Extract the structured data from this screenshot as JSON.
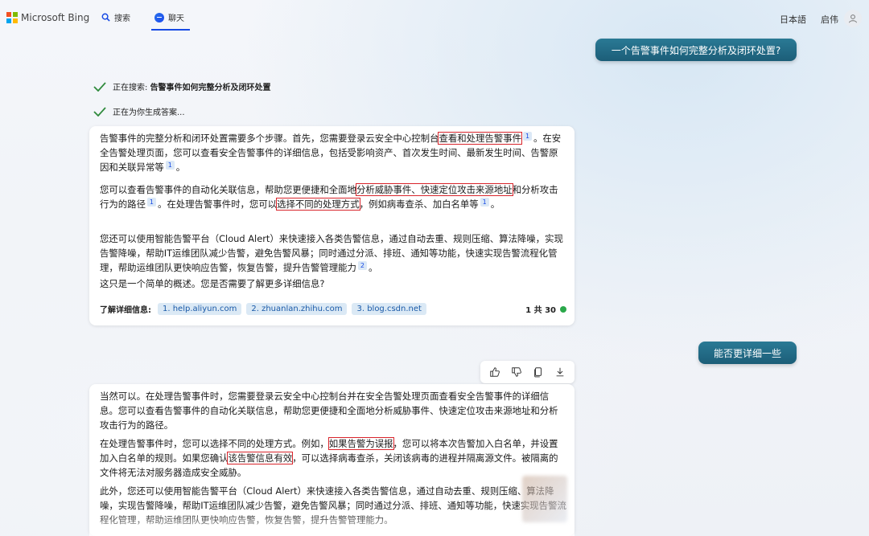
{
  "header": {
    "brand": "Microsoft Bing",
    "tabs": [
      {
        "label": "搜索"
      },
      {
        "label": "聊天"
      }
    ],
    "language": "日本語",
    "user_name": "启伟"
  },
  "colors": {
    "accent": "#174ae4",
    "user_bubble": "#1f6580",
    "highlight_box": "#d8242b",
    "live_dot": "#2aa84a"
  },
  "conversation": {
    "user_message_1": "一个告警事件如何完整分析及闭环处置?",
    "status_1_prefix": "正在搜索: ",
    "status_1_query": "告警事件如何完整分析及闭环处置",
    "status_2": "正在为你生成答案...",
    "answer_1": {
      "p1_a": "告警事件的完整分析和闭环处置需要多个步骤。首先，您需要登录云安全中心控制台",
      "p1_hl": "查看和处理告警事件",
      "p1_sup": "1",
      "p1_b": "。在安全告警处理页面，您可以查看安全告警事件的详细信息，包括受影响资产、首次发生时间、最新发生时间、告警原因和关联异常等",
      "p1_sup2": "1",
      "p1_c": "。",
      "p2_a": "您可以查看告警事件的自动化关联信息，帮助您更便捷和全面地",
      "p2_hl": "分析威胁事件、快速定位攻击来源地址",
      "p2_b": "和分析攻击行为的路径",
      "p2_sup": "1",
      "p2_c": "。在处理告警事件时，您可以",
      "p2_hl2": "选择不同的处理方式",
      "p2_d": "，例如病毒查杀、加白名单等",
      "p2_sup2": "1",
      "p2_e": "。",
      "p3": "您还可以使用智能告警平台（Cloud Alert）来快速接入各类告警信息，通过自动去重、规则压缩、算法降噪，实现告警降噪，帮助IT运维团队减少告警，避免告警风暴；同时通过分派、排班、通知等功能，快速实现告警流程化管理，帮助运维团队更快响应告警，恢复告警，提升告警管理能力",
      "p3_sup": "2",
      "p3_end": "。",
      "p4": "这只是一个简单的概述。您是否需要了解更多详细信息?",
      "learn_more_label": "了解详细信息:",
      "sources": [
        {
          "label": "1. help.aliyun.com"
        },
        {
          "label": "2. zhuanlan.zhihu.com"
        },
        {
          "label": "3. blog.csdn.net"
        }
      ],
      "counter": "1 共 30"
    },
    "user_message_2": "能否更详细一些",
    "answer_2": {
      "p1": "当然可以。在处理告警事件时，您需要登录云安全中心控制台并在安全告警处理页面查看安全告警事件的详细信息。您可以查看告警事件的自动化关联信息，帮助您更便捷和全面地分析威胁事件、快速定位攻击来源地址和分析攻击行为的路径。",
      "p2_a": "在处理告警事件时，您可以选择不同的处理方式。例如，",
      "p2_hl": "如果告警为误报",
      "p2_b": "，您可以将本次告警加入白名单，并设置加入白名单的规则。如果您确认",
      "p2_hl2": "该告警信息有效",
      "p2_c": "，可以选择病毒查杀，关闭该病毒的进程并隔离源文件。被隔离的文件将无法对服务器造成安全威胁。",
      "p3": "此外，您还可以使用智能告警平台（Cloud Alert）来快速接入各类告警信息，通过自动去重、规则压缩、算法降噪，实现告警降噪，帮助IT运维团队减少告警，避免告警风暴；同时通过分派、排班、通知等功能，快速实现告警流程化管理，帮助运维团队更快响应告警，恢复告警，提升告警管理能力。"
    },
    "toolbar": [
      {
        "icon": "thumbs-up-icon"
      },
      {
        "icon": "thumbs-down-icon"
      },
      {
        "icon": "copy-icon"
      },
      {
        "icon": "download-icon"
      }
    ]
  }
}
